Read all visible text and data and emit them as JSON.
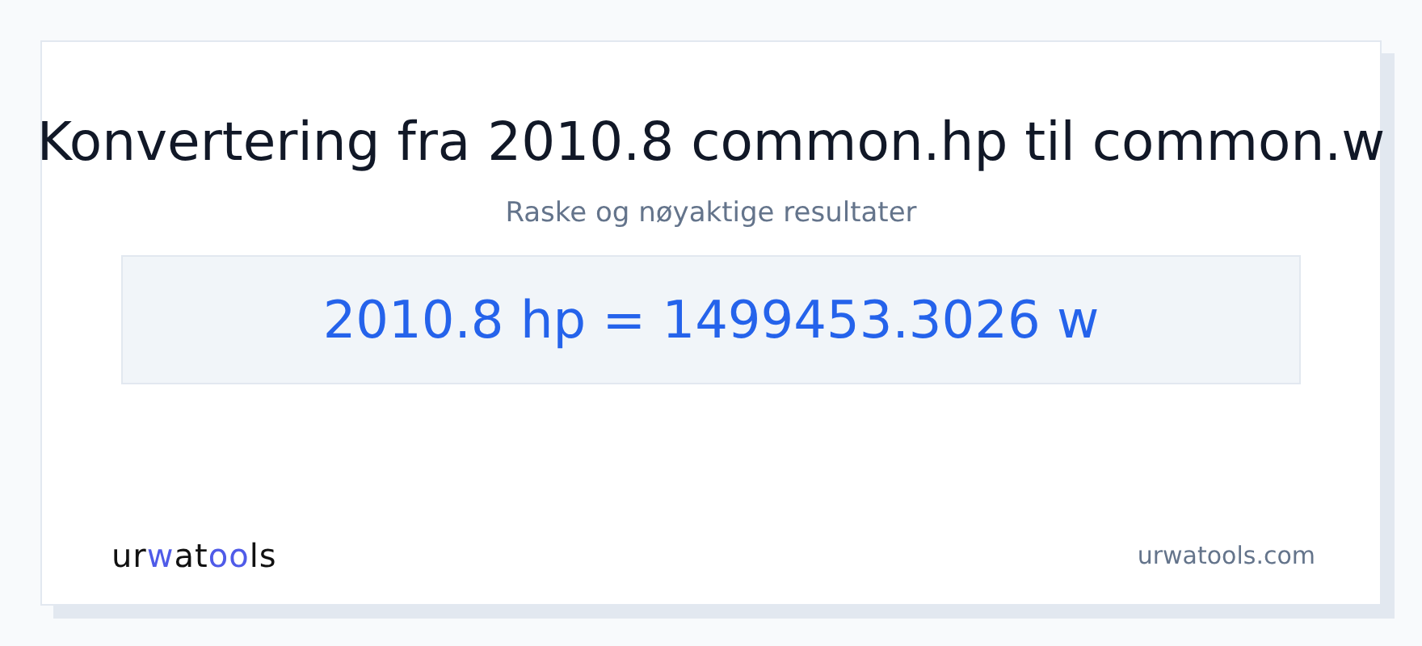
{
  "title": "Konvertering fra 2010.8 common.hp til common.w",
  "subtitle": "Raske og nøyaktige resultater",
  "result": "2010.8 hp = 1499453.3026 w",
  "logo": {
    "parts": [
      {
        "text": "ur",
        "accent": false
      },
      {
        "text": "w",
        "accent": true
      },
      {
        "text": "at",
        "accent": false
      },
      {
        "text": "oo",
        "accent": true
      },
      {
        "text": "ls",
        "accent": false
      }
    ]
  },
  "site": "urwatools.com"
}
